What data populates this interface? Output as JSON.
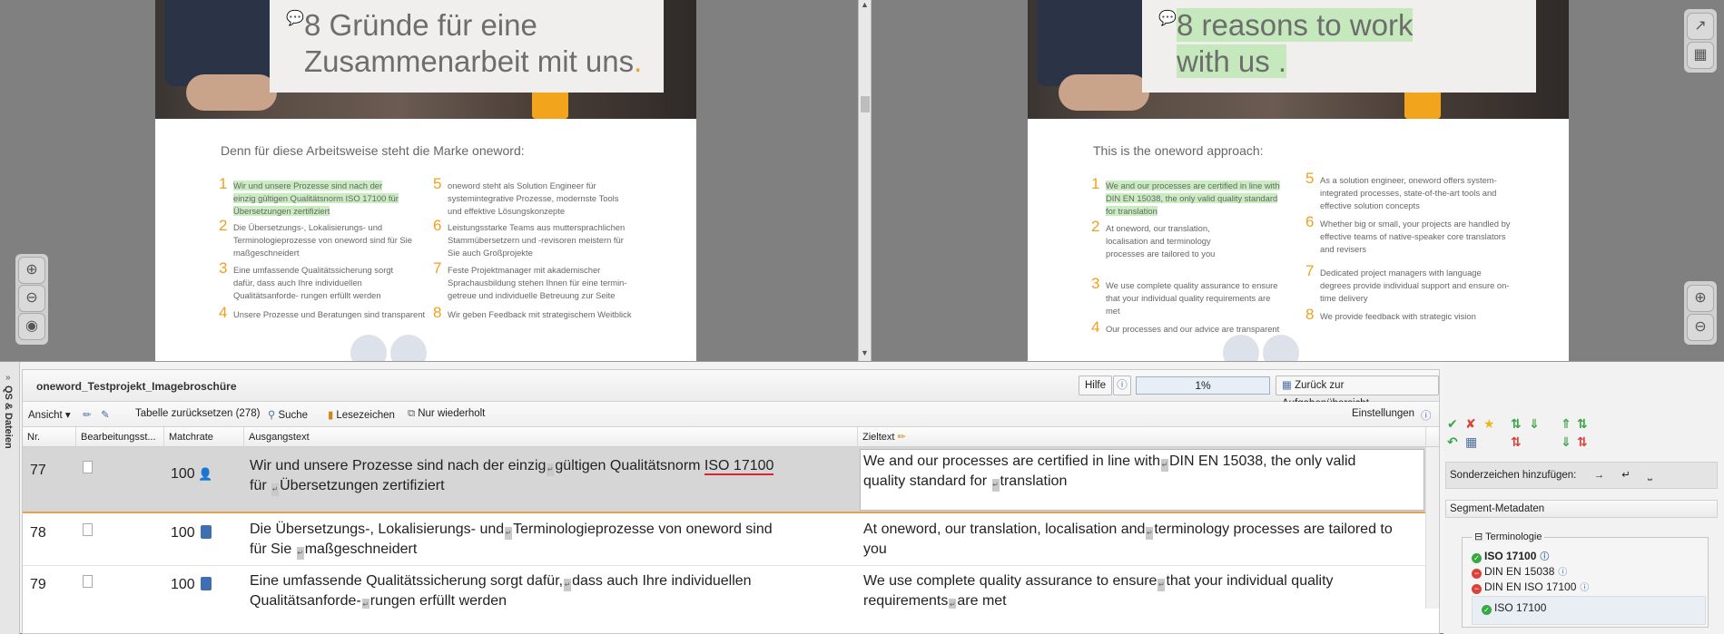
{
  "preview_left": {
    "title_line1": "8 Gründe für eine",
    "title_line2": "Zusammenarbeit mit uns",
    "title_dot": ".",
    "subtitle": "Denn für diese Arbeitsweise steht die Marke oneword:",
    "items": [
      {
        "num": "1",
        "text": "Wir und unsere Prozesse sind nach der einzig gültigen Qualitätsnorm ISO 17100 für Übersetzungen zertifiziert"
      },
      {
        "num": "2",
        "text": "Die Übersetzungs-, Lokalisierungs- und Terminologieprozesse von oneword sind für Sie maßgeschneidert"
      },
      {
        "num": "3",
        "text": "Eine umfassende Qualitätssicherung sorgt dafür, dass auch Ihre individuellen Qualitätsanforde- rungen erfüllt werden"
      },
      {
        "num": "4",
        "text": "Unsere Prozesse und Beratungen sind transparent"
      },
      {
        "num": "5",
        "text": "oneword steht als Solution Engineer für systemintegrative Prozesse, modernste Tools und effektive Lösungskonzepte"
      },
      {
        "num": "6",
        "text": "Leistungsstarke Teams aus muttersprachlichen Stammübersetzern und -revisoren meistern für Sie auch Großprojekte"
      },
      {
        "num": "7",
        "text": "Feste Projektmanager mit akademischer Sprachausbildung stehen Ihnen für eine termin- getreue und individuelle Betreuung zur Seite"
      },
      {
        "num": "8",
        "text": "Wir geben Feedback mit strategischem Weitblick"
      }
    ]
  },
  "preview_right": {
    "title_line1": "8 reasons to work",
    "title_line2": "with us .",
    "subtitle": "This is the oneword approach:",
    "items": [
      {
        "num": "1",
        "text": "We and our processes are certified in line with DIN EN 15038, the only valid quality standard for translation"
      },
      {
        "num": "2",
        "text": "At oneword, our translation, localisation and terminology processes are tailored to you"
      },
      {
        "num": "3",
        "text": "We use complete quality assurance to ensure that your individual quality requirements are met"
      },
      {
        "num": "4",
        "text": "Our processes and our advice are transparent"
      },
      {
        "num": "5",
        "text": "As a solution engineer, oneword offers system- integrated processes, state-of-the-art tools and effective solution concepts"
      },
      {
        "num": "6",
        "text": "Whether big or small, your projects are handled by effective teams of native-speaker core translators and revisers"
      },
      {
        "num": "7",
        "text": "Dedicated project managers with language degrees provide individual support and ensure on-time delivery"
      },
      {
        "num": "8",
        "text": "We provide feedback with strategic vision"
      }
    ]
  },
  "side_tab": {
    "label": "QS & Dateien"
  },
  "editor": {
    "project_name": "oneword_Testprojekt_Imagebroschüre",
    "help_label": "Hilfe",
    "progress": "1%",
    "progress_value": 1,
    "back_label": "Zurück zur Aufgabenübersicht",
    "toolbar": {
      "view": "Ansicht",
      "reset_table": "Tabelle zurücksetzen (278)",
      "search": "Suche",
      "bookmarks": "Lesezeichen",
      "repeated_only": "Nur wiederholt",
      "settings": "Einstellungen"
    },
    "columns": {
      "nr": "Nr.",
      "status": "Bearbeitungsst...",
      "matchrate": "Matchrate",
      "source": "Ausgangstext",
      "target": "Zieltext"
    },
    "rows": [
      {
        "nr": "77",
        "match": "100",
        "source_a": "Wir und unsere Prozesse sind nach der einzig",
        "source_b": "gültigen Qualitätsnorm ",
        "source_term": "ISO 17100",
        "source_c": "für ",
        "source_d": "Übersetzungen zertifiziert",
        "target_a": "We and our processes are certified in line with",
        "target_b": "DIN EN 15038, the only valid",
        "target_c": "quality standard for ",
        "target_d": "translation"
      },
      {
        "nr": "78",
        "match": "100",
        "source_a": "Die Übersetzungs-, Lokalisierungs- und",
        "source_b": "Terminologieprozesse von oneword sind",
        "source_c": "für Sie ",
        "source_d": "maßgeschneidert",
        "target_a": "At oneword, our translation, localisation and",
        "target_b": "terminology processes are tailored to",
        "target_c": "you"
      },
      {
        "nr": "79",
        "match": "100",
        "source_a": "Eine umfassende Qualitätssicherung sorgt dafür,",
        "source_b": "dass auch Ihre individuellen",
        "source_c": "Qualitätsanforde-",
        "source_d": "rungen erfüllt werden",
        "target_a": "We use complete quality assurance to ensure",
        "target_b": "that your individual quality",
        "target_c": "requirements",
        "target_d": "are met"
      }
    ]
  },
  "right_panel": {
    "special_chars_label": "Sonderzeichen hinzufügen:",
    "special_chars": [
      "→",
      "↵",
      "⎵"
    ],
    "segment_meta_label": "Segment-Metadaten",
    "terminology_label": "Terminologie",
    "terms": [
      {
        "text": "ISO 17100",
        "status": "ok",
        "bold": true
      },
      {
        "text": "DIN EN 15038",
        "status": "forbidden"
      },
      {
        "text": "DIN EN ISO 17100",
        "status": "forbidden"
      }
    ],
    "target_term": "ISO 17100"
  },
  "colors": {
    "accent_orange": "#f0a020",
    "highlight_green": "#c9ecc1",
    "comment_red": "#d62828"
  }
}
